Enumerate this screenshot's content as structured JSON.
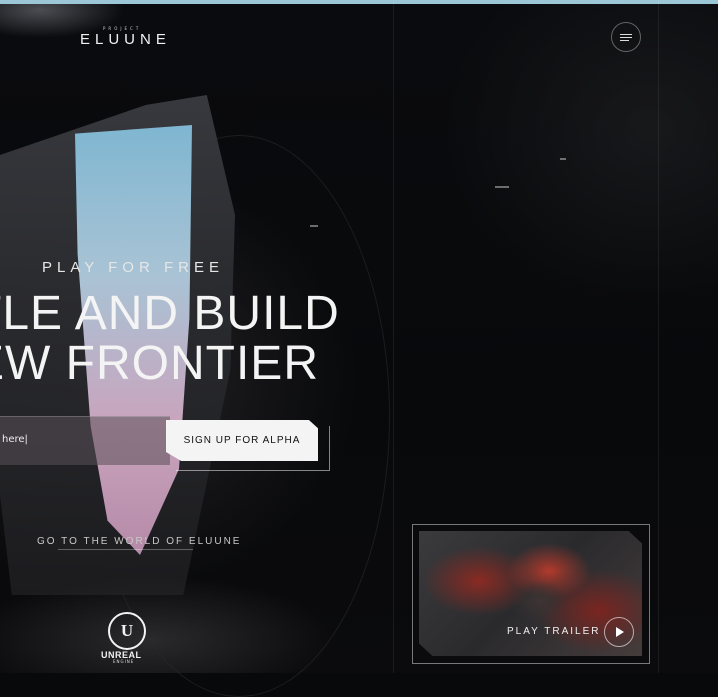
{
  "logo": {
    "sup": "PROJECT",
    "main": "ELUUNE"
  },
  "menu": {
    "icon": "hamburger-icon"
  },
  "hero": {
    "eyebrow": "PLAY FOR FREE",
    "headline_line1": "TLE AND BUILD",
    "headline_line2": "EW FRONTIER"
  },
  "signup": {
    "input_value": "here|",
    "button_label": "SIGN UP FOR ALPHA"
  },
  "world_link": "GO TO THE WORLD OF ELUUNE",
  "engine": {
    "line1": "UNREAL",
    "line2": "ENGINE",
    "icon": "unreal-logo-icon"
  },
  "trailer": {
    "label": "PLAY TRAILER",
    "icon": "play-icon"
  },
  "colors": {
    "accent_bar": "#9bc7d6",
    "button_bg": "#f4f4f4",
    "background": "#08090b"
  }
}
